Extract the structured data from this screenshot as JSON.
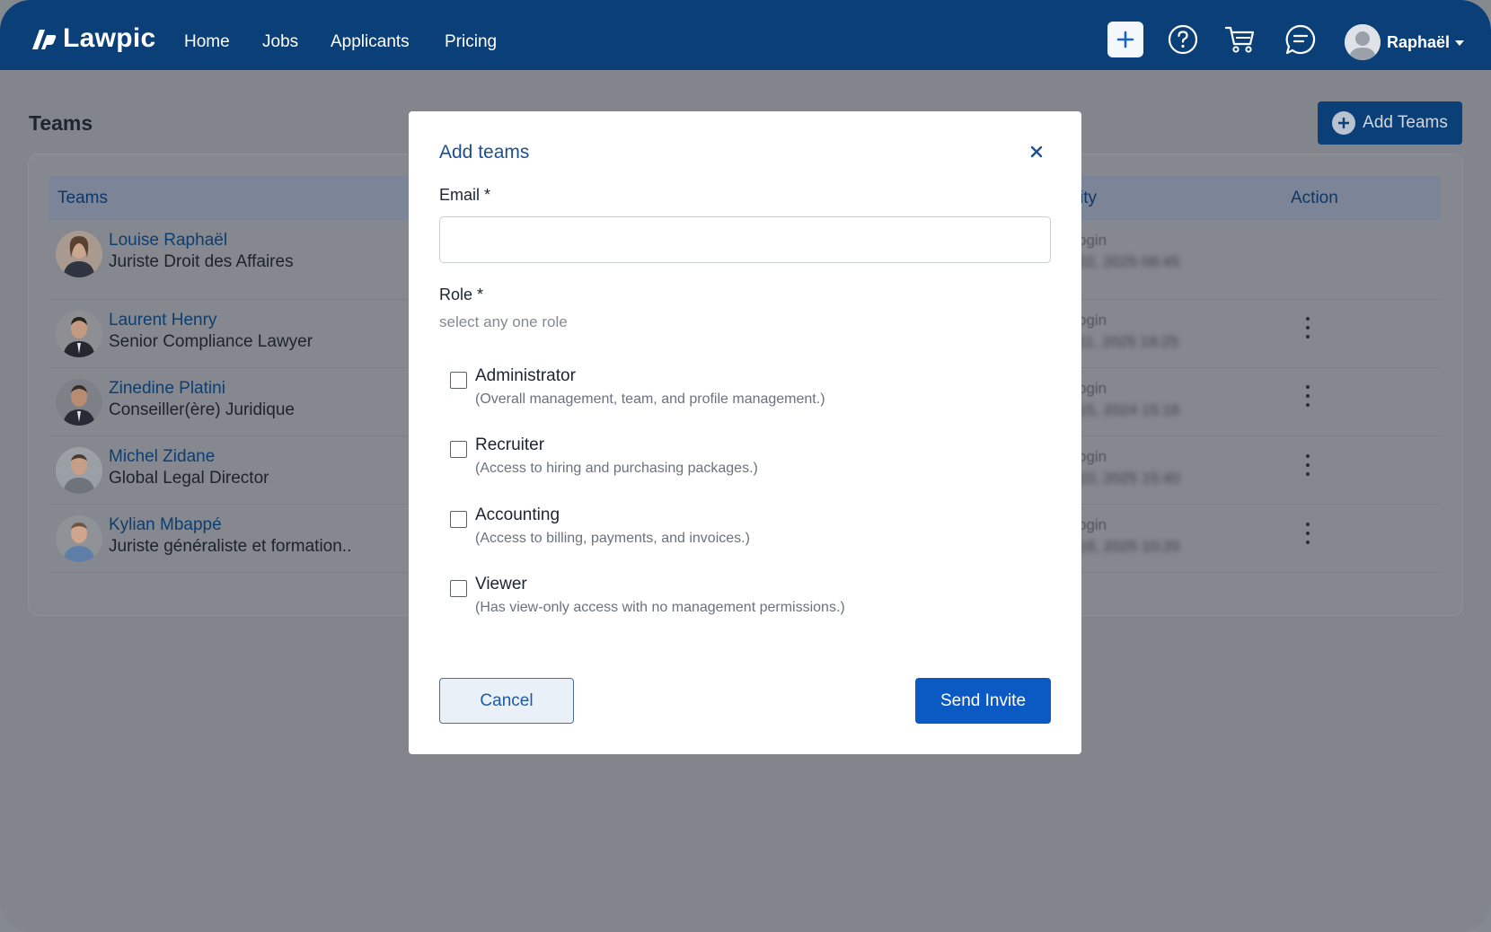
{
  "app": {
    "logo_text": "Lawpic",
    "nav": [
      "Home",
      "Jobs",
      "Applicants",
      "Pricing"
    ],
    "user_name": "Raphaël",
    "icons": [
      "plus-icon",
      "help-icon",
      "cart-icon",
      "chat-icon",
      "user-avatar",
      "caret-down-icon"
    ]
  },
  "page": {
    "title": "Teams",
    "add_button_label": "Add Teams",
    "table": {
      "headers": [
        "Teams",
        "ity",
        "Action"
      ],
      "rows": [
        {
          "name": "Louise Raphaël",
          "title": "Juriste Droit des Affaires",
          "activity_label": "ogin",
          "activity_value": "02, 2025 08:45",
          "has_action": false
        },
        {
          "name": "Laurent Henry",
          "title": "Senior Compliance Lawyer",
          "activity_label": "ogin",
          "activity_value": "11, 2025 18:25",
          "has_action": true
        },
        {
          "name": "Zinedine Platini",
          "title": "Conseiller(ère) Juridique",
          "activity_label": "ogin",
          "activity_value": "15, 2024 15:16",
          "has_action": true
        },
        {
          "name": "Michel Zidane",
          "title": "Global Legal Director",
          "activity_label": "ogin",
          "activity_value": "10, 2025 15:40",
          "has_action": true
        },
        {
          "name": "Kylian Mbappé",
          "title": "Juriste généraliste et formation..",
          "activity_label": "ogin",
          "activity_value": "18, 2025 10:20",
          "has_action": true
        }
      ]
    }
  },
  "modal": {
    "title": "Add teams",
    "email_label": "Email *",
    "email_value": "",
    "role_label": "Role *",
    "role_hint": "select any one role",
    "roles": [
      {
        "name": "Administrator",
        "desc": "(Overall management, team, and profile management.)",
        "checked": false
      },
      {
        "name": "Recruiter",
        "desc": "(Access to hiring and purchasing packages.)",
        "checked": false
      },
      {
        "name": "Accounting",
        "desc": "(Access to billing, payments, and invoices.)",
        "checked": false
      },
      {
        "name": "Viewer",
        "desc": "(Has view-only access with no management permissions.)",
        "checked": false
      }
    ],
    "cancel_label": "Cancel",
    "send_label": "Send Invite"
  },
  "colors": {
    "nav_bg": "#0b3f78",
    "primary": "#0b5ac4",
    "overlay": "#82868c"
  }
}
